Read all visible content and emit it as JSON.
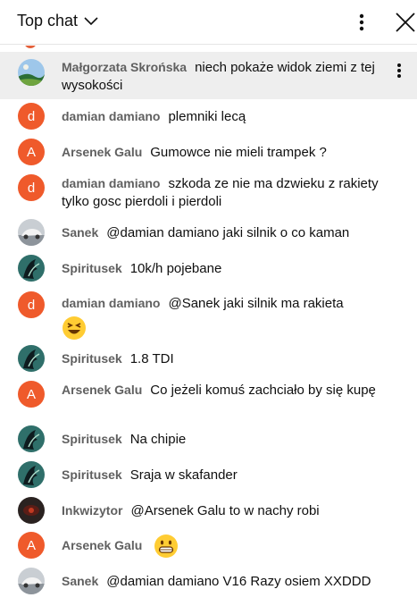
{
  "header": {
    "title": "Top chat"
  },
  "messages": [
    {
      "author": "Małgorzata Skrońska",
      "text": "niech pokaże widok ziemi z tej wysokości",
      "avatar": "photo-landscape"
    },
    {
      "author": "damian damiano",
      "text": "plemniki lecą",
      "avatar_letter": "d"
    },
    {
      "author": "Arsenek Galu",
      "text": "Gumowce nie mieli trampek ?",
      "avatar_letter": "A"
    },
    {
      "author": "damian damiano",
      "text": "szkoda ze nie ma dzwieku z rakiety tylko gosc pierdoli i pierdoli",
      "avatar_letter": "d"
    },
    {
      "author": "Sanek",
      "text": "@damian damiano jaki silnik o co kaman",
      "avatar": "photo-car"
    },
    {
      "author": "Spiritusek",
      "text": "10k/h pojebane",
      "avatar": "photo-dragon"
    },
    {
      "author": "damian damiano",
      "text": "@Sanek jaki silnik ma rakieta",
      "avatar_letter": "d",
      "emoji": "laughing-face-emoji"
    },
    {
      "author": "Spiritusek",
      "text": "1.8 TDI",
      "avatar": "photo-dragon"
    },
    {
      "author": "Arsenek Galu",
      "text": "Co jeżeli komuś zachciało by się kupę",
      "avatar_letter": "A"
    },
    {
      "author": "Spiritusek",
      "text": "Na chipie",
      "avatar": "photo-dragon"
    },
    {
      "author": "Spiritusek",
      "text": "Sraja w skafander",
      "avatar": "photo-dragon"
    },
    {
      "author": "Inkwizytor",
      "text": "@Arsenek Galu to w nachy robi",
      "avatar": "photo-dark"
    },
    {
      "author": "Arsenek Galu",
      "text": "",
      "avatar_letter": "A",
      "emoji": "grinning-face-emoji"
    },
    {
      "author": "Sanek",
      "text": "@damian damiano V16 Razy osiem XXDDD",
      "avatar": "photo-car"
    }
  ],
  "colors": {
    "letter_avatar": "#ef5a2b",
    "author": "#606060",
    "highlight_row": "#eeeeee"
  }
}
